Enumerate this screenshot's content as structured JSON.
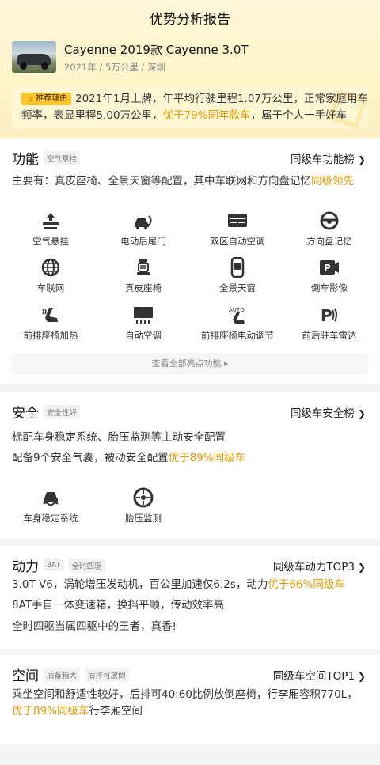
{
  "page_title": "优势分析报告",
  "car": {
    "name": "Cayenne 2019款 Cayenne 3.0T",
    "meta": "2021年 / 5万公里 / 深圳"
  },
  "reason": {
    "tag": "推荐理由",
    "text_a": "2021年1月上牌，年平均行驶里程1.07万公里，正常家庭用车频率，表显里程5.00万公里，",
    "text_hl": "优于79%同年款车",
    "text_b": "，属于个人一手好车"
  },
  "features": {
    "title": "功能",
    "tag": "空气悬挂",
    "link": "同级车功能榜",
    "summary_a": "主要有：真皮座椅、全景天窗等配置，其中车联网和方向盘记忆",
    "summary_hl": "同级领先",
    "items": [
      {
        "label": "空气悬挂",
        "icon": "air-suspension-icon"
      },
      {
        "label": "电动后尾门",
        "icon": "power-tailgate-icon"
      },
      {
        "label": "双区自动空调",
        "icon": "dual-zone-ac-icon"
      },
      {
        "label": "方向盘记忆",
        "icon": "steering-memory-icon"
      },
      {
        "label": "车联网",
        "icon": "connected-car-icon"
      },
      {
        "label": "真皮座椅",
        "icon": "leather-seat-icon"
      },
      {
        "label": "全景天窗",
        "icon": "panoramic-sunroof-icon"
      },
      {
        "label": "倒车影像",
        "icon": "reverse-camera-icon"
      },
      {
        "label": "前排座椅加热",
        "icon": "seat-heating-icon"
      },
      {
        "label": "自动空调",
        "icon": "auto-ac-icon"
      },
      {
        "label": "前排座椅电动调节",
        "icon": "power-seat-icon"
      },
      {
        "label": "前后驻车雷达",
        "icon": "parking-radar-icon"
      }
    ],
    "view_all": "查看全部亮点功能 ▸"
  },
  "safety": {
    "title": "安全",
    "tag": "安全性好",
    "link": "同级车安全榜",
    "line1": "标配车身稳定系统、胎压监测等主动安全配置",
    "line2_a": "配备9个安全气囊，被动安全配置",
    "line2_hl": "优于89%同级车",
    "items": [
      {
        "label": "车身稳定系统",
        "icon": "stability-control-icon"
      },
      {
        "label": "胎压监测",
        "icon": "tire-pressure-icon"
      }
    ]
  },
  "power": {
    "title": "动力",
    "tags": [
      "8AT",
      "全时四驱"
    ],
    "link": "同级车动力TOP3",
    "line1_a": "3.0T V6，涡轮增压发动机，百公里加速仅6.2s，动力",
    "line1_hl": "优于66%同级车",
    "line2": "8AT手自一体变速箱，换挡平顺，传动效率高",
    "line3": "全时四驱当属四驱中的王者，真香!"
  },
  "space": {
    "title": "空间",
    "tags": [
      "后备箱大",
      "后排可放倒"
    ],
    "link": "同级车空间TOP1",
    "text_a": "乘坐空间和舒适性较好，后排可40:60比例放倒座椅，行李厢容积770L，",
    "text_hl": "优于89%同级车",
    "text_b": "行李厢空间"
  },
  "colors": {
    "accent": "#e19a00",
    "tag_yellow": "#ffc62e"
  }
}
